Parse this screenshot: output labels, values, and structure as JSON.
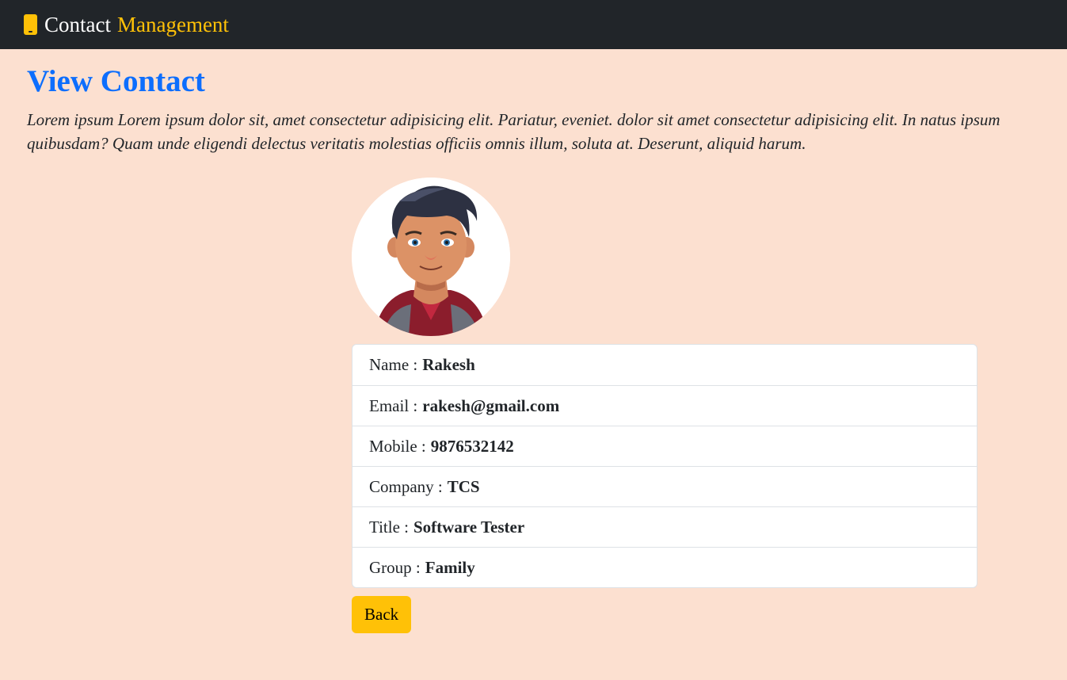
{
  "navbar": {
    "brand_word1": "Contact",
    "brand_word2": "Management",
    "brand_icon": "phone-icon",
    "accent_color": "#ffc107"
  },
  "page": {
    "title": "View Contact",
    "description_line1": "Lorem ipsum Lorem ipsum dolor sit, amet consectetur adipisicing elit. Pariatur, eveniet. dolor sit amet consectetur adipisicing elit. In natus ipsum",
    "description_line2": "quibusdam? Quam unde eligendi delectus veritatis molestias officiis omnis illum, soluta at. Deserunt, aliquid harum.",
    "title_color": "#0d6efd",
    "background_color": "#fce0d0"
  },
  "contact": {
    "avatar_icon": "avatar-icon",
    "fields": [
      {
        "label": "Name :",
        "value": "Rakesh"
      },
      {
        "label": "Email :",
        "value": "rakesh@gmail.com"
      },
      {
        "label": "Mobile :",
        "value": "9876532142"
      },
      {
        "label": "Company :",
        "value": "TCS"
      },
      {
        "label": "Title :",
        "value": "Software Tester"
      },
      {
        "label": "Group :",
        "value": "Family"
      }
    ]
  },
  "actions": {
    "back_label": "Back"
  }
}
